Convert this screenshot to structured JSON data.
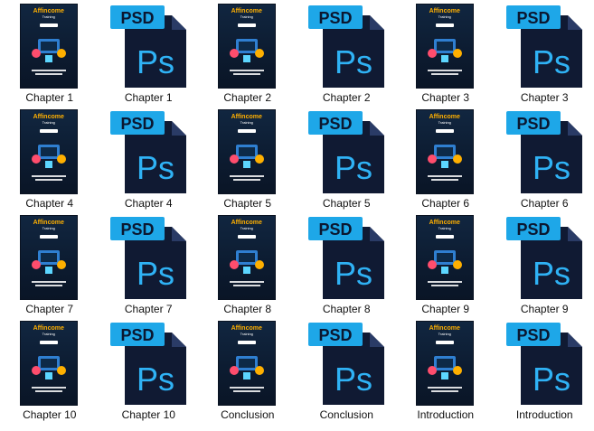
{
  "items": [
    {
      "label": "Chapter 1",
      "kind": "cover"
    },
    {
      "label": "Chapter 1",
      "kind": "psd"
    },
    {
      "label": "Chapter 2",
      "kind": "cover"
    },
    {
      "label": "Chapter 2",
      "kind": "psd"
    },
    {
      "label": "Chapter 3",
      "kind": "cover"
    },
    {
      "label": "Chapter 3",
      "kind": "psd"
    },
    {
      "label": "Chapter 4",
      "kind": "cover"
    },
    {
      "label": "Chapter 4",
      "kind": "psd"
    },
    {
      "label": "Chapter 5",
      "kind": "cover"
    },
    {
      "label": "Chapter 5",
      "kind": "psd"
    },
    {
      "label": "Chapter 6",
      "kind": "cover"
    },
    {
      "label": "Chapter 6",
      "kind": "psd"
    },
    {
      "label": "Chapter 7",
      "kind": "cover"
    },
    {
      "label": "Chapter 7",
      "kind": "psd"
    },
    {
      "label": "Chapter 8",
      "kind": "cover"
    },
    {
      "label": "Chapter 8",
      "kind": "psd"
    },
    {
      "label": "Chapter 9",
      "kind": "cover"
    },
    {
      "label": "Chapter 9",
      "kind": "psd"
    },
    {
      "label": "Chapter 10",
      "kind": "cover"
    },
    {
      "label": "Chapter 10",
      "kind": "psd"
    },
    {
      "label": "Conclusion",
      "kind": "cover"
    },
    {
      "label": "Conclusion",
      "kind": "psd"
    },
    {
      "label": "Introduction",
      "kind": "cover"
    },
    {
      "label": "Introduction",
      "kind": "psd"
    }
  ],
  "psd": {
    "tab_text": "PSD",
    "logo_text": "Ps"
  },
  "cover": {
    "brand": "Affincome",
    "brand_sub": "Training"
  },
  "colors": {
    "psd_tab": "#1ea7e8",
    "psd_body": "#101a33",
    "psd_fold": "#2a3b66",
    "ps_text": "#2fb2f5",
    "cover_bg": "#112640",
    "brand": "#ffb000"
  }
}
